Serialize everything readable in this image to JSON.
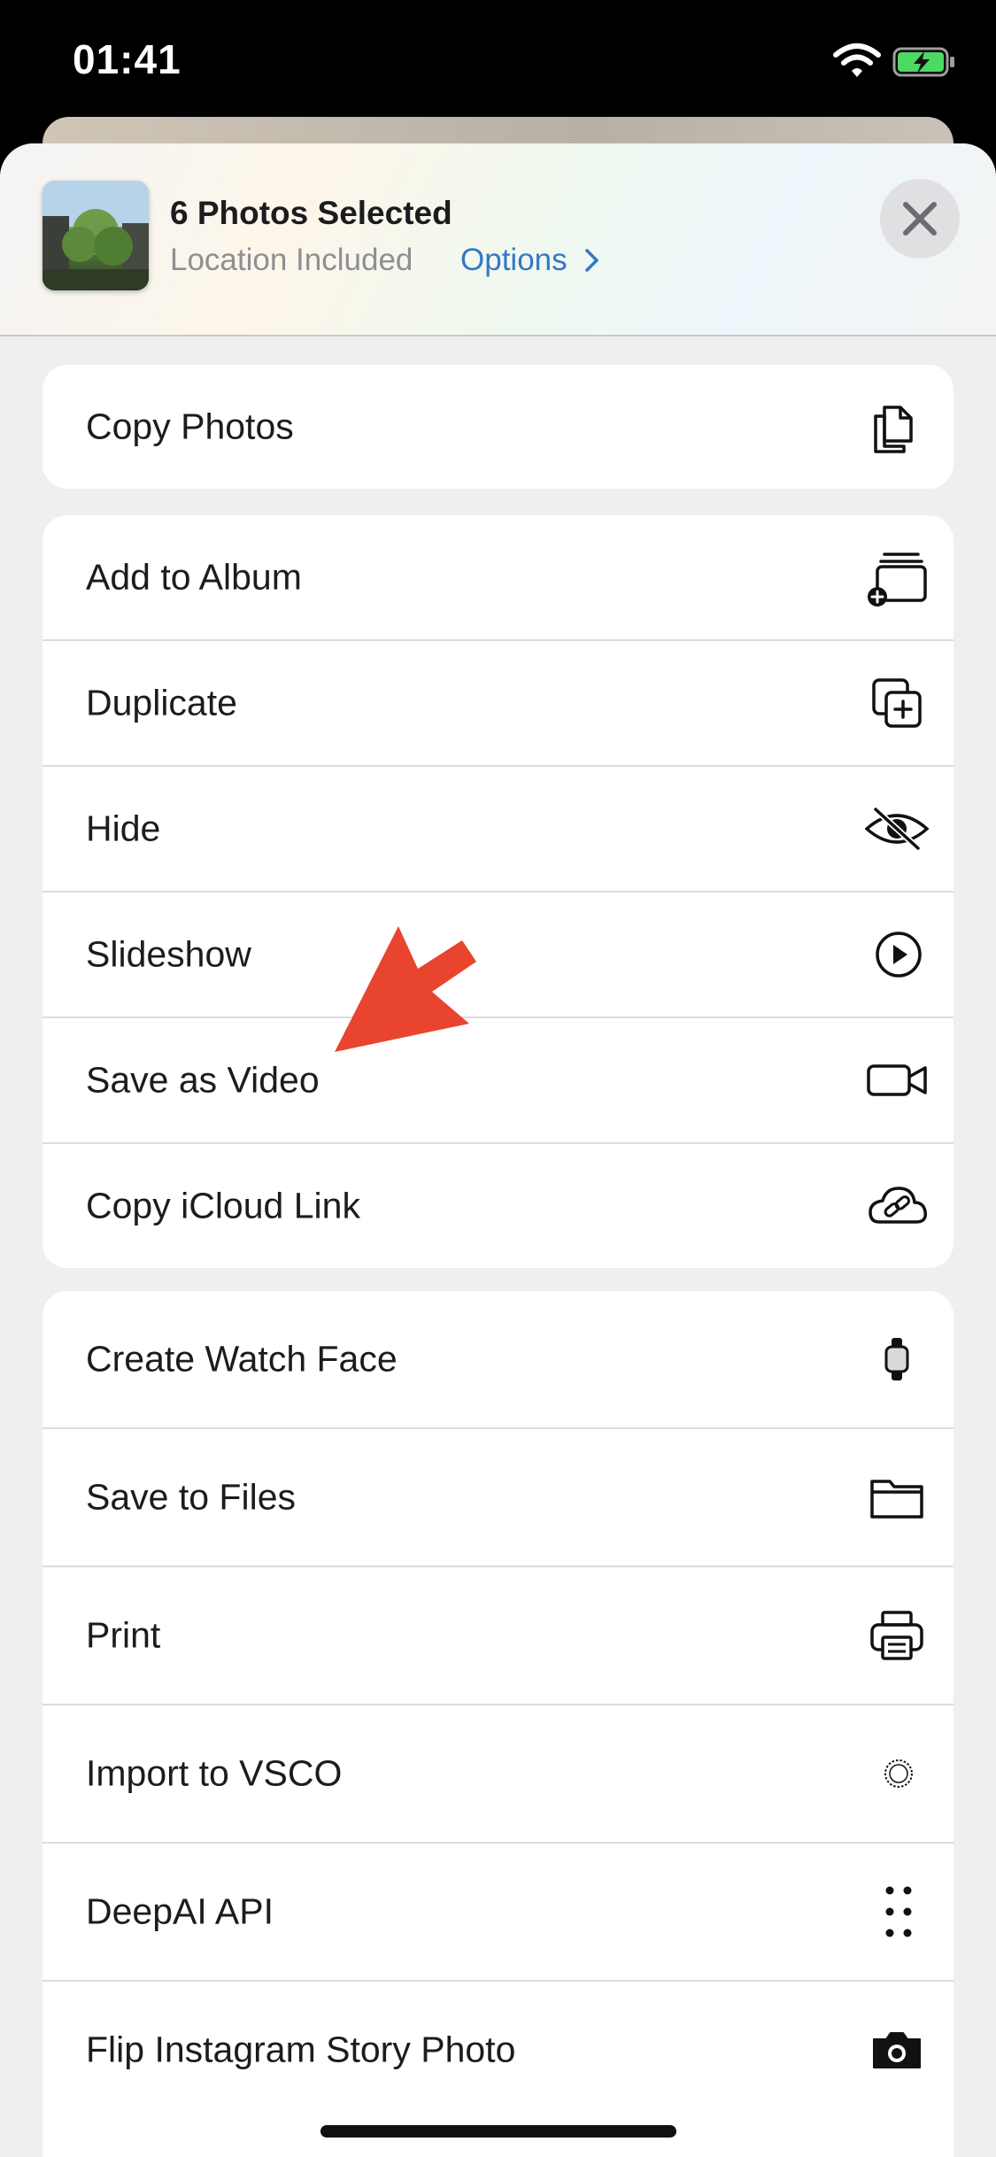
{
  "status": {
    "time": "01:41"
  },
  "header": {
    "title": "6 Photos Selected",
    "subtitle": "Location Included",
    "options_label": "Options"
  },
  "groups": [
    {
      "items": [
        {
          "label": "Copy Photos",
          "icon": "copy-document-icon"
        }
      ]
    },
    {
      "items": [
        {
          "label": "Add to Album",
          "icon": "add-to-album-icon"
        },
        {
          "label": "Duplicate",
          "icon": "duplicate-icon"
        },
        {
          "label": "Hide",
          "icon": "eye-slash-icon"
        },
        {
          "label": "Slideshow",
          "icon": "play-circle-icon"
        },
        {
          "label": "Save as Video",
          "icon": "video-camera-icon"
        },
        {
          "label": "Copy iCloud Link",
          "icon": "cloud-link-icon"
        }
      ]
    },
    {
      "items": [
        {
          "label": "Create Watch Face",
          "icon": "watch-icon"
        },
        {
          "label": "Save to Files",
          "icon": "folder-icon"
        },
        {
          "label": "Print",
          "icon": "printer-icon"
        },
        {
          "label": "Import to VSCO",
          "icon": "vsco-icon"
        },
        {
          "label": "DeepAI API",
          "icon": "dots-grid-icon"
        },
        {
          "label": "Flip Instagram Story Photo",
          "icon": "camera-icon"
        }
      ]
    }
  ]
}
